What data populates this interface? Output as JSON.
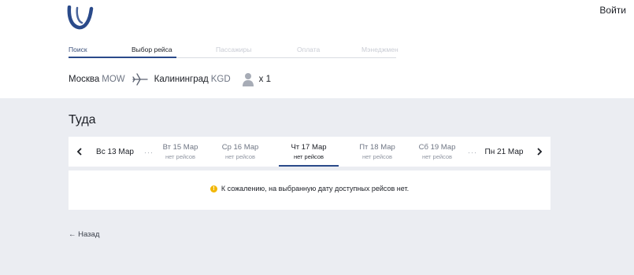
{
  "header": {
    "login_label": "Войти",
    "brand_color": "#2a4a8a"
  },
  "steps": [
    {
      "label": "Поиск",
      "state": "done"
    },
    {
      "label": "Выбор рейса",
      "state": "active"
    },
    {
      "label": "Пассажиры",
      "state": "pending"
    },
    {
      "label": "Оплата",
      "state": "pending"
    },
    {
      "label": "Мэнеджмен",
      "state": "pending"
    }
  ],
  "route": {
    "from_city": "Москва",
    "from_code": "MOW",
    "to_city": "Калининград",
    "to_code": "KGD",
    "passengers": "x 1"
  },
  "section_title": "Туда",
  "dates": {
    "cells": [
      {
        "date": "Вс 13 Мар",
        "status": ""
      },
      {
        "date": "Вт 15 Мар",
        "status": "нет рейсов"
      },
      {
        "date": "Ср 16 Мар",
        "status": "нет рейсов"
      },
      {
        "date": "Чт 17 Мар",
        "status": "нет рейсов"
      },
      {
        "date": "Пт 18 Мар",
        "status": "нет рейсов"
      },
      {
        "date": "Сб 19 Мар",
        "status": "нет рейсов"
      },
      {
        "date": "Пн 21 Мар",
        "status": ""
      }
    ],
    "selected_index": 3
  },
  "message": {
    "icon": "warning-icon",
    "text": "К сожалению, на выбранную дату доступных рейсов нет."
  },
  "back_label": "← Назад"
}
